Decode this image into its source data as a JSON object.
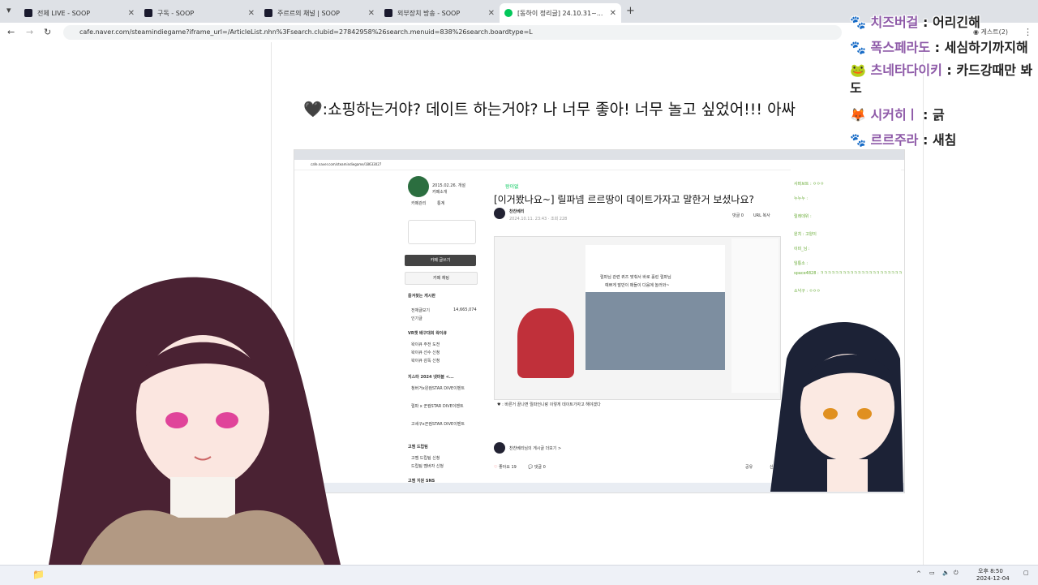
{
  "browser": {
    "tabs": [
      {
        "label": "전체 LIVE - SOOP"
      },
      {
        "label": "구독 - SOOP"
      },
      {
        "label": "주르르의 채널 | SOOP"
      },
      {
        "label": "외부장치 방송 - SOOP"
      },
      {
        "label": "[동하이 정리글] 24.10.31~..."
      }
    ],
    "new_tab": "+",
    "url": "cafe.naver.com/steamindiegame?iframe_url=/ArticleList.nhn%3Fsearch.clubid=27842958%26search.menuid=838%26search.boardtype=L",
    "profile_label": "게스트(2)"
  },
  "headline": ":쇼핑하는거야? 데이트 하는거야? 나 너무 좋아! 너무 놀고 싶었어!!! 아싸",
  "inner": {
    "url": "cafe.naver.com/steamindiegame/18633027",
    "board": "왕이없",
    "title": "[이거봤나요~] 릴파넴 르르땅이 데이트가자고 말한거 보셨나요?",
    "author": "찬찬베리",
    "date": "2024.10.11. 23:43 · 조회 228",
    "comment_label": "댓글 0",
    "url_copy": "URL 복사",
    "caption": "릴파님 관련 퀴즈 맞춰서 바로 홀린 릴파님",
    "caption2": "예쁘게 말만이 매들이 다음에 놀러와~",
    "quote": "♥ : 바른거 끝나면 릴파언니랑 이렇게 데이트가자고 해야겠다",
    "author_more": "찬찬베리님의 게시글 더보기 >",
    "likes": "좋아요 19",
    "comments": "댓글 0",
    "share": "공유",
    "report": "신고",
    "sidebar": {
      "cafe_date": "2015.02.26. 개설",
      "cafe_intro": "카페소개",
      "manage": "카페관리",
      "stats": "통계",
      "write_btn": "카페 글쓰기",
      "chat_btn": "카페 채팅",
      "fav_boards": "즐겨찾는 게시판",
      "all_posts": "전체글보기",
      "all_count": "14,665,074",
      "popular": "인기글",
      "sec1": "VR챗 배구대회 왁이큐",
      "sec1_items": [
        "왁이큐 주전 도전",
        "왁이큐 선수 신청",
        "왁이큐 감독 신청"
      ],
      "sec2": "지스타 2024 넷마블 <...",
      "sec2_items": [
        "청버거x왼컴STAR DIVE이벤트",
        "릴파 x 꾼컴STAR DIVE이벤트",
        "고세구x꾼컴STAR DIVE이벤트"
      ],
      "sec3": "고멤 드립팀",
      "sec3_items": [
        "고멤 드립팀 신청",
        "드립팀 멤버자 신청"
      ],
      "sec4": "고멤 지원 SNS"
    },
    "chat": [
      {
        "name": "사퍼브트",
        "msg": "ㅇㅇㅇ"
      },
      {
        "name": "누누누",
        "msg": ""
      },
      {
        "name": "릴레데위",
        "msg": ""
      },
      {
        "name": "원치",
        "msg": "고양이"
      },
      {
        "name": "이미_님",
        "msg": ""
      },
      {
        "name": "임통소",
        "msg": ""
      },
      {
        "name": "space4828",
        "msg": "ㅋㅋㅋㅋㅋㅋㅋㅋㅋㅋㅋㅋㅋㅋㅋㅋㅋㅋㅋㅋㅋㅋ"
      },
      {
        "name": "소낙구",
        "msg": "ㅇㅇㅇ"
      }
    ]
  },
  "chat_overlay": [
    {
      "name": "치즈버걸",
      "msg": "어리긴해"
    },
    {
      "name": "폭스페라도",
      "msg": "세심하기까지해"
    },
    {
      "name": "츠네타다이키",
      "msg": "카드강때만 봐도"
    },
    {
      "name": "시커히ㅣ",
      "msg": "긁"
    },
    {
      "name": "르르주라",
      "msg": "새침"
    }
  ],
  "taskbar": {
    "time": "오후 8:50",
    "date": "2024-12-04"
  },
  "colors": {
    "naver_green": "#03c75a",
    "chat_name": "#8e5aa8",
    "tab_bg": "#dee1e6"
  }
}
